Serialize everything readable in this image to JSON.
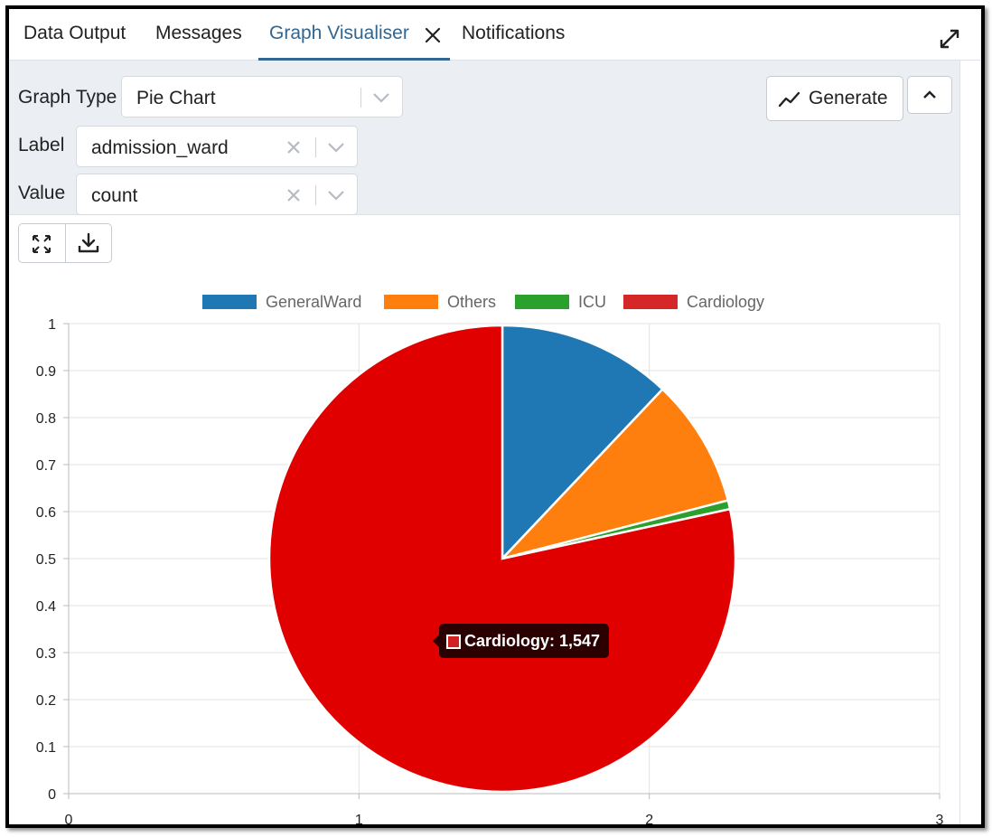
{
  "tabs": [
    {
      "label": "Data Output",
      "active": false
    },
    {
      "label": "Messages",
      "active": false
    },
    {
      "label": "Graph Visualiser",
      "active": true,
      "closable": true
    },
    {
      "label": "Notifications",
      "active": false
    }
  ],
  "options": {
    "graph_type": {
      "label": "Graph Type",
      "value": "Pie Chart"
    },
    "label_field": {
      "label": "Label",
      "value": "admission_ward"
    },
    "value_field": {
      "label": "Value",
      "value": "count"
    },
    "generate_label": "Generate"
  },
  "icons": {
    "expand": "expand-icon",
    "close": "close-icon",
    "generate": "line-chart-icon",
    "collapse": "chevron-up-icon",
    "fullscreen": "fullscreen-icon",
    "download": "download-icon"
  },
  "colors": {
    "accent": "#326690",
    "tooltip_bg": "#2a0000"
  },
  "chart_data": {
    "type": "pie",
    "legend_position": "top",
    "categories": [
      "GeneralWard",
      "Others",
      "ICU",
      "Cardiology"
    ],
    "values": [
      238,
      176,
      12,
      1547
    ],
    "colors": [
      "#1f77b4",
      "#ff7f0e",
      "#2ca02c",
      "#d62728"
    ],
    "highlighted": "Cardiology",
    "slice_fill_highlight": "#e00000",
    "x_ticks": [
      "0",
      "1",
      "2",
      "3"
    ],
    "y_ticks": [
      "0",
      "0.1",
      "0.2",
      "0.3",
      "0.4",
      "0.5",
      "0.6",
      "0.7",
      "0.8",
      "0.9",
      "1"
    ],
    "xlim": [
      0,
      3
    ],
    "ylim": [
      0,
      1
    ],
    "grid": true,
    "tooltip": {
      "label": "Cardiology: 1,547"
    }
  }
}
